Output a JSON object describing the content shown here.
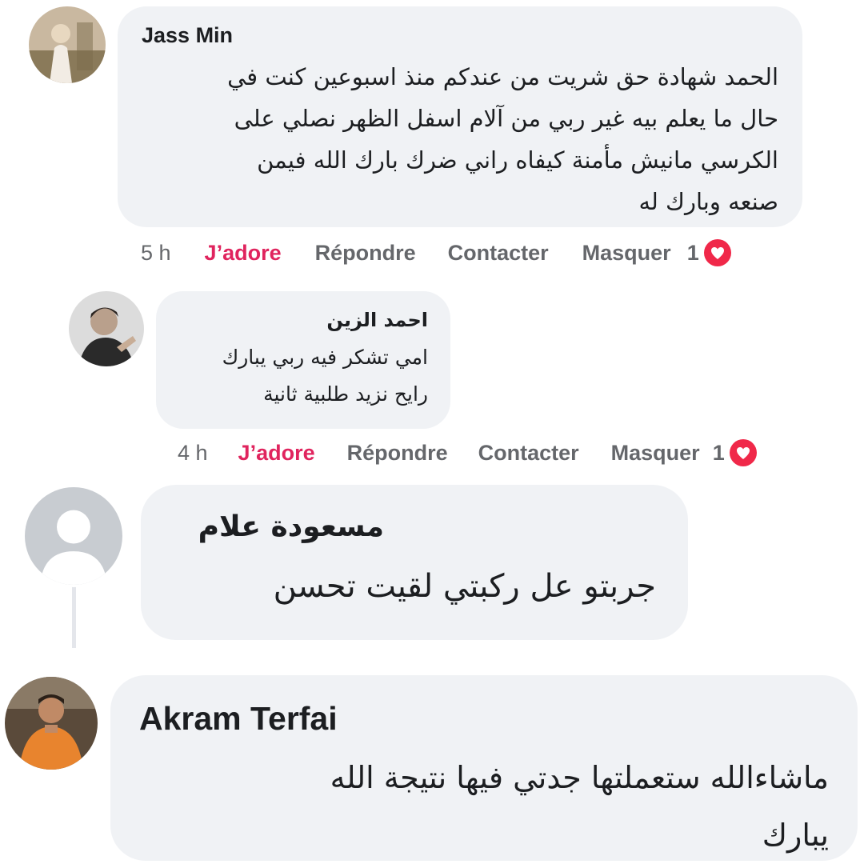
{
  "comments": [
    {
      "author": "Jass  Min",
      "lines": [
        "الحمد شهادة حق شريت من عندكم منذ اسبوعين كنت في",
        "حال ما يعلم بيه غير ربي من آلام اسفل الظهر نصلي على",
        "الكرسي مانيش مأمنة كيفاه راني ضرك بارك الله فيمن",
        "صنعه وبارك له"
      ],
      "time": "5 h",
      "like_label": "J’adore",
      "reply_label": "Répondre",
      "contact_label": "Contacter",
      "hide_label": "Masquer",
      "reaction_count": "1"
    },
    {
      "author": "احمد الزين",
      "lines": [
        "امي تشكر فيه ربي يبارك",
        "رايح نزيد طلبية ثانية"
      ],
      "time": "4 h",
      "like_label": "J’adore",
      "reply_label": "Répondre",
      "contact_label": "Contacter",
      "hide_label": "Masquer",
      "reaction_count": "1"
    },
    {
      "author": "مسعودة علام",
      "lines": [
        "جربتو عل ركبتي لقيت تحسن"
      ]
    },
    {
      "author": "Akram Terfai",
      "lines": [
        "ماشاءالله ستعملتها جدتي فيها نتيجة الله",
        "يبارك"
      ]
    }
  ],
  "colors": {
    "bubble": "#f0f2f5",
    "like_active": "#e0245e",
    "meta_text": "#65676b",
    "heart": "#f02849"
  },
  "icons": [
    "heart-reaction-icon",
    "default-profile-icon"
  ]
}
